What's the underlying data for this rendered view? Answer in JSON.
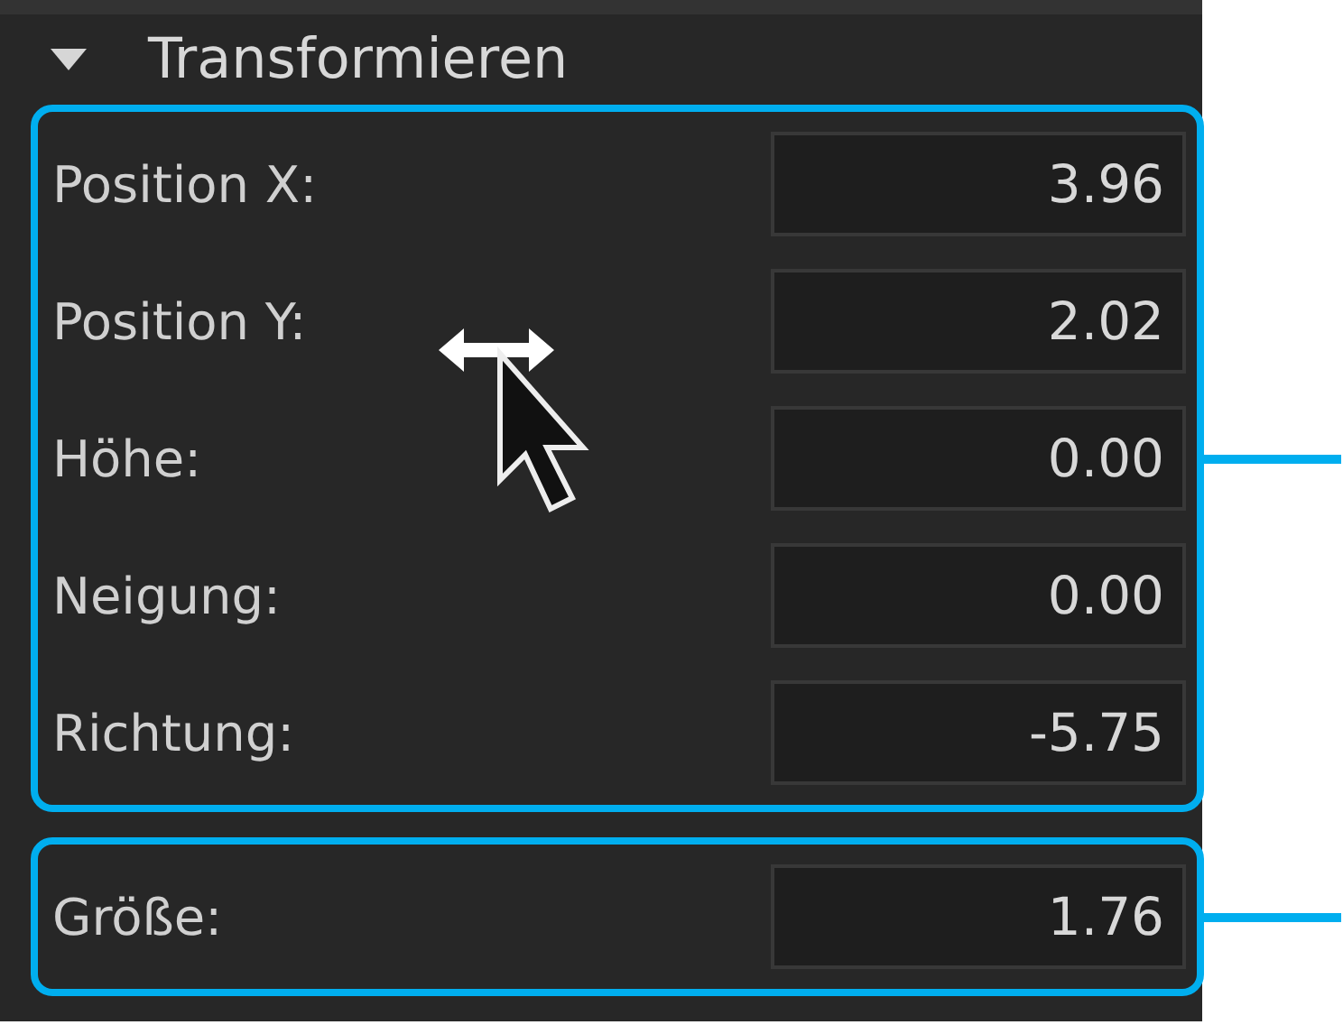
{
  "section": {
    "title": "Transformieren",
    "expanded": true
  },
  "groups": [
    {
      "fields": [
        {
          "label": "Position X:",
          "value": "3.96"
        },
        {
          "label": "Position Y:",
          "value": "2.02"
        },
        {
          "label": "Höhe:",
          "value": "0.00"
        },
        {
          "label": "Neigung:",
          "value": "0.00"
        },
        {
          "label": "Richtung:",
          "value": "-5.75"
        }
      ]
    },
    {
      "fields": [
        {
          "label": "Größe:",
          "value": "1.76"
        }
      ]
    }
  ]
}
